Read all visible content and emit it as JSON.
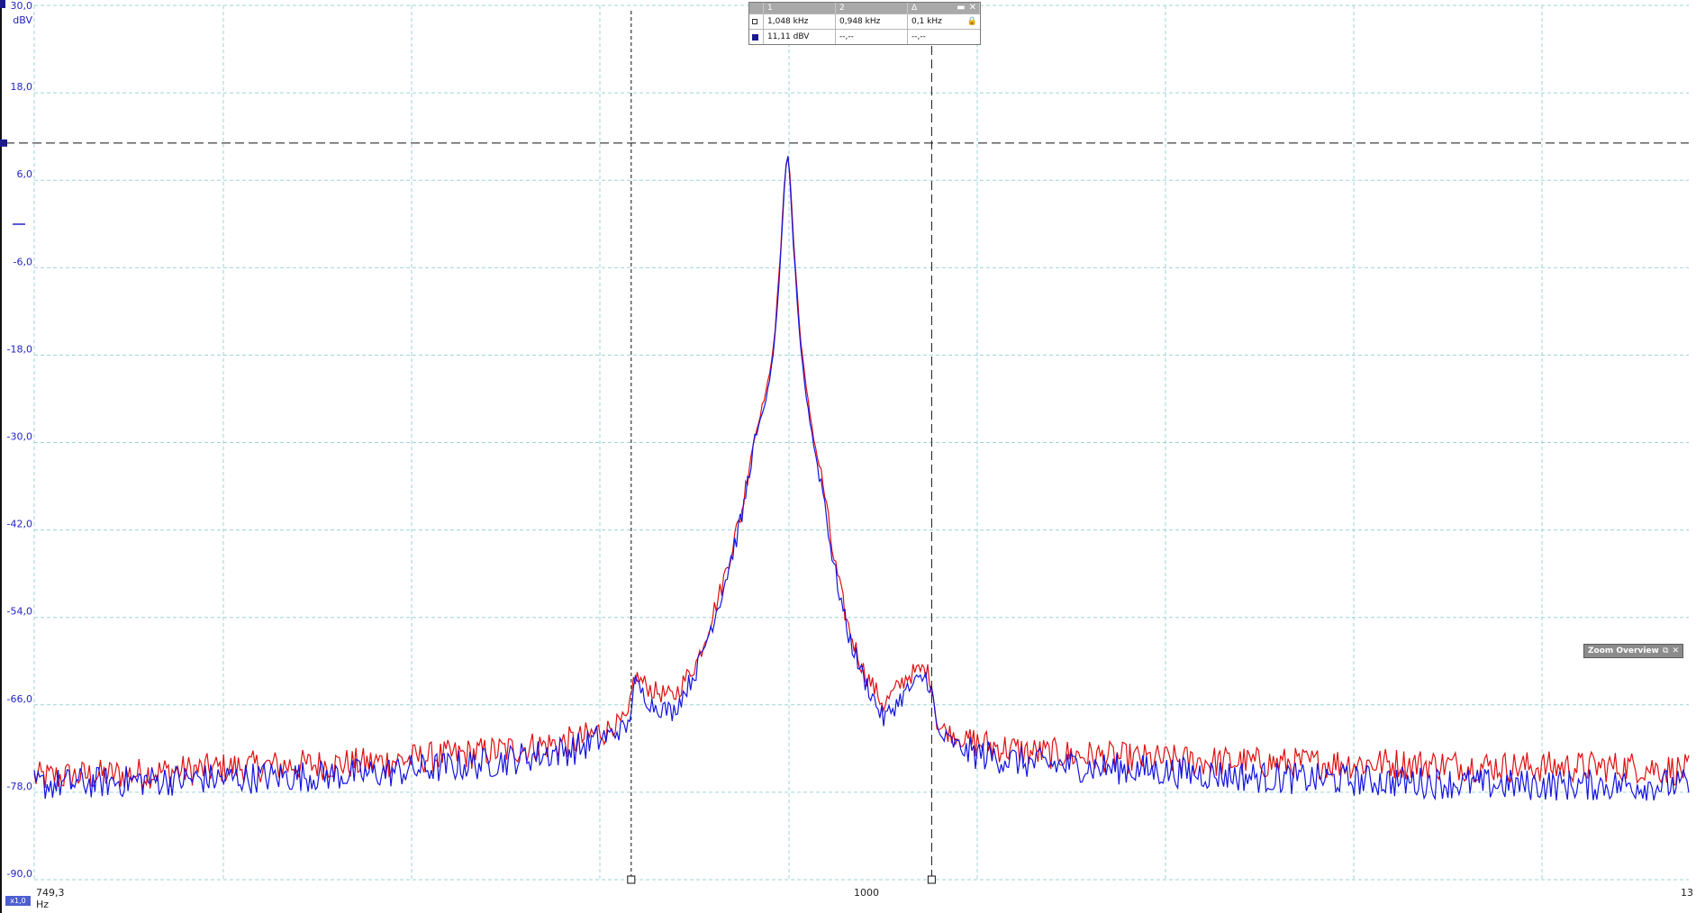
{
  "chart_data": {
    "type": "line",
    "ylabel": "dBV",
    "xlabel": "Hz",
    "ylim": [
      -90,
      30
    ],
    "xlim": [
      749.3,
      1300
    ],
    "y_ticks": [
      "30,0",
      "18,0",
      "6,0",
      "-6,0",
      "-18,0",
      "-30,0",
      "-42,0",
      "-54,0",
      "-66,0",
      "-78,0",
      "-90,0"
    ],
    "y_tick_values": [
      30,
      18,
      6,
      -6,
      -18,
      -30,
      -42,
      -54,
      -66,
      -78,
      -90
    ],
    "x_tick_labels": [
      "749,3",
      "1000",
      "13"
    ],
    "x_tick_values": [
      749.3,
      1000,
      1300
    ],
    "grid": true,
    "cursors": {
      "x1": 1048,
      "x2": 948,
      "y": 11.11
    },
    "series": [
      {
        "color": "#e01010",
        "x": [
          749.3,
          780,
          820,
          860,
          900,
          930,
          947,
          949,
          955,
          962,
          970,
          978,
          985,
          988,
          991,
          994,
          996,
          998,
          999,
          1000,
          1001,
          1002,
          1004,
          1006,
          1009,
          1012,
          1015,
          1020,
          1025,
          1032,
          1040,
          1046,
          1048,
          1050,
          1060,
          1080,
          1120,
          1160,
          1200,
          1240,
          1280,
          1300
        ],
        "values": [
          -76,
          -75.5,
          -74.5,
          -74,
          -72.5,
          -71,
          -68,
          -62,
          -64,
          -65,
          -60,
          -50,
          -39,
          -31,
          -26,
          -21,
          -14,
          -2,
          6,
          10,
          6,
          -2,
          -14,
          -22,
          -30,
          -36,
          -45,
          -55,
          -61,
          -66,
          -62,
          -61,
          -63,
          -69,
          -71,
          -72.5,
          -73.5,
          -74,
          -74,
          -74.5,
          -74.5,
          -75
        ]
      },
      {
        "color": "#1414e0",
        "x": [
          749.3,
          780,
          820,
          860,
          900,
          930,
          947,
          949,
          955,
          962,
          970,
          978,
          985,
          988,
          991,
          994,
          996,
          998,
          999,
          1000,
          1001,
          1002,
          1004,
          1006,
          1009,
          1012,
          1015,
          1020,
          1025,
          1032,
          1040,
          1046,
          1048,
          1050,
          1060,
          1080,
          1120,
          1160,
          1200,
          1240,
          1280,
          1300
        ],
        "values": [
          -77,
          -76.5,
          -76,
          -75.5,
          -74,
          -72,
          -69,
          -63,
          -66,
          -67,
          -61,
          -51,
          -40,
          -32,
          -27,
          -22,
          -15,
          -3,
          5,
          10,
          5,
          -3,
          -15,
          -23,
          -31,
          -37,
          -46,
          -56,
          -62,
          -68,
          -64,
          -62,
          -64,
          -70,
          -72.5,
          -74,
          -75,
          -76,
          -76.5,
          -77,
          -77,
          -77
        ]
      }
    ]
  },
  "axis_marks": {
    "y_unit": "dBV"
  },
  "readout": {
    "headers": [
      "1",
      "2",
      "Δ"
    ],
    "row1": [
      "1,048 kHz",
      "0,948 kHz",
      "0,1 kHz"
    ],
    "row2": [
      "11,11 dBV",
      "--,--",
      "--,--"
    ],
    "minimize_glyph": "▬",
    "close_glyph": "✕",
    "lock_glyph": "🔒"
  },
  "zoom_overview": {
    "title": "Zoom Overview",
    "restore_glyph": "⧉",
    "close_glyph": "✕"
  },
  "scale_badge": "x1,0",
  "colors": {
    "grid": "#9fd3d6",
    "cursor": "#111111",
    "axis_label": "#2323c8"
  }
}
